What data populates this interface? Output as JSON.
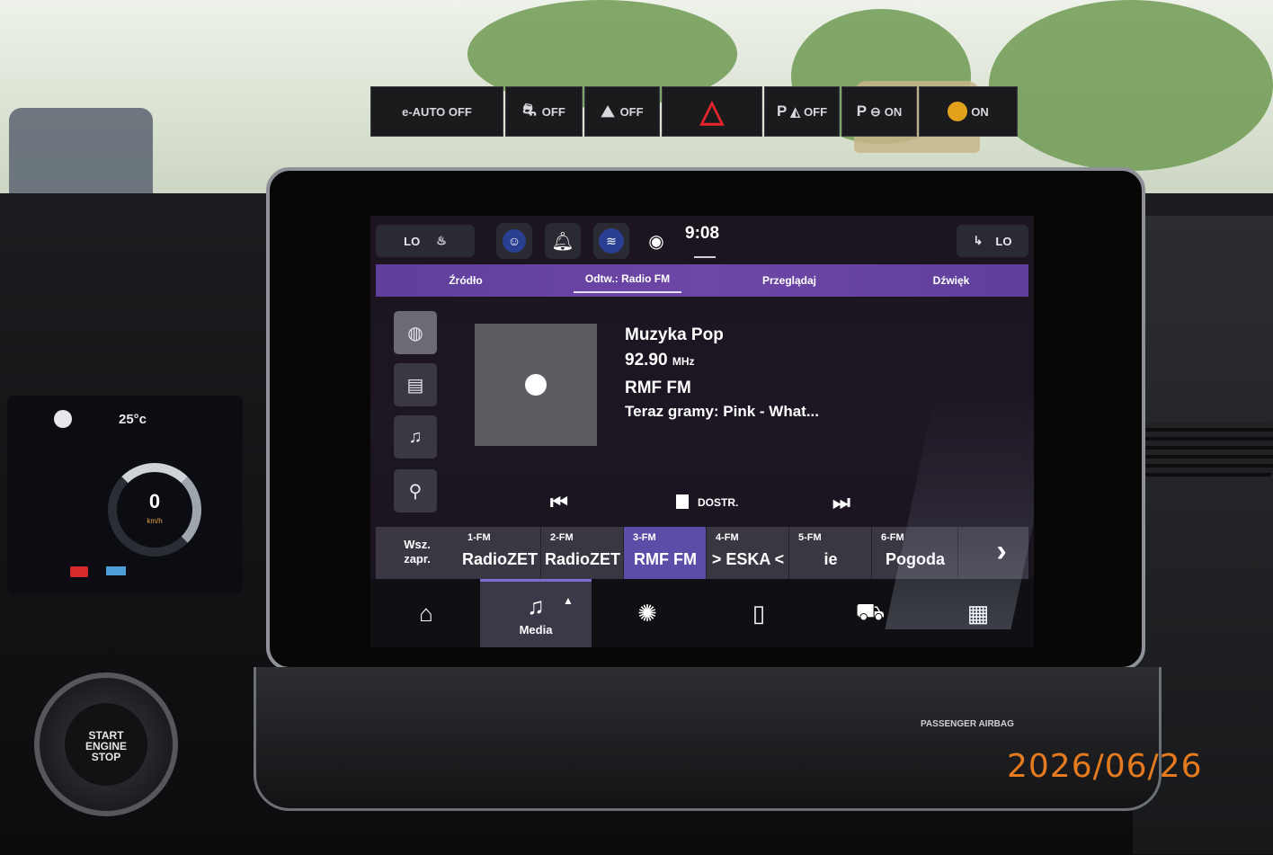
{
  "cluster": {
    "temperature": "25°c",
    "speed": "0",
    "speed_unit": "km/h"
  },
  "start_stop": {
    "label_line1": "START",
    "label_line2": "ENGINE",
    "label_line3": "STOP"
  },
  "status_bar": {
    "left_pill": "LO",
    "right_pill": "LO",
    "time": "9:08",
    "icons": [
      "user-profile-icon",
      "bell-icon",
      "wifi-icon",
      "map-pin-icon"
    ]
  },
  "tabs": [
    {
      "label": "Źródło",
      "active": false
    },
    {
      "label": "Odtw.: Radio FM",
      "active": true
    },
    {
      "label": "Przeglądaj",
      "active": false
    },
    {
      "label": "Dźwięk",
      "active": false
    }
  ],
  "sources": [
    {
      "icon": "radio-icon",
      "active": true
    },
    {
      "icon": "dab-icon",
      "active": false
    },
    {
      "icon": "bluetooth-audio-icon",
      "active": false
    },
    {
      "icon": "usb-icon",
      "active": false
    }
  ],
  "now_playing": {
    "genre": "Muzyka Pop",
    "frequency": "92.90",
    "frequency_unit": "MHz",
    "station": "RMF FM",
    "now_playing_text": "Teraz gramy: Pink - What..."
  },
  "transport": {
    "prev_icon": "skip-previous-icon",
    "tune_label": "DOSTR.",
    "next_icon": "skip-next-icon"
  },
  "presets": {
    "all_label_line1": "Wsz.",
    "all_label_line2": "zapr.",
    "items": [
      {
        "num": "1-FM",
        "name": "RadioZET",
        "active": false
      },
      {
        "num": "2-FM",
        "name": "RadioZET",
        "active": false
      },
      {
        "num": "3-FM",
        "name": "RMF FM",
        "active": true
      },
      {
        "num": "4-FM",
        "name": "> ESKA <",
        "active": false
      },
      {
        "num": "5-FM",
        "name": "ie",
        "active": false
      },
      {
        "num": "6-FM",
        "name": "Pogoda",
        "active": false
      }
    ],
    "next_icon": "chevron-right-icon"
  },
  "nav": {
    "items": [
      {
        "icon": "home-icon",
        "label": ""
      },
      {
        "icon": "music-note-icon",
        "label": "Media",
        "active": true
      },
      {
        "icon": "climate-icon",
        "label": ""
      },
      {
        "icon": "phone-icon",
        "label": ""
      },
      {
        "icon": "car-icon",
        "label": ""
      },
      {
        "icon": "apps-grid-icon",
        "label": ""
      }
    ]
  },
  "switches": {
    "eauto": "e-AUTO OFF",
    "traction": "OFF",
    "hill": "OFF",
    "park_assist": "P",
    "park_assist_state": "OFF",
    "park_sense": "P",
    "park_sense_state": "ON",
    "airbag_state": "ON",
    "airbag_label": "PASSENGER AIRBAG"
  },
  "datestamp": "2026/06/26"
}
